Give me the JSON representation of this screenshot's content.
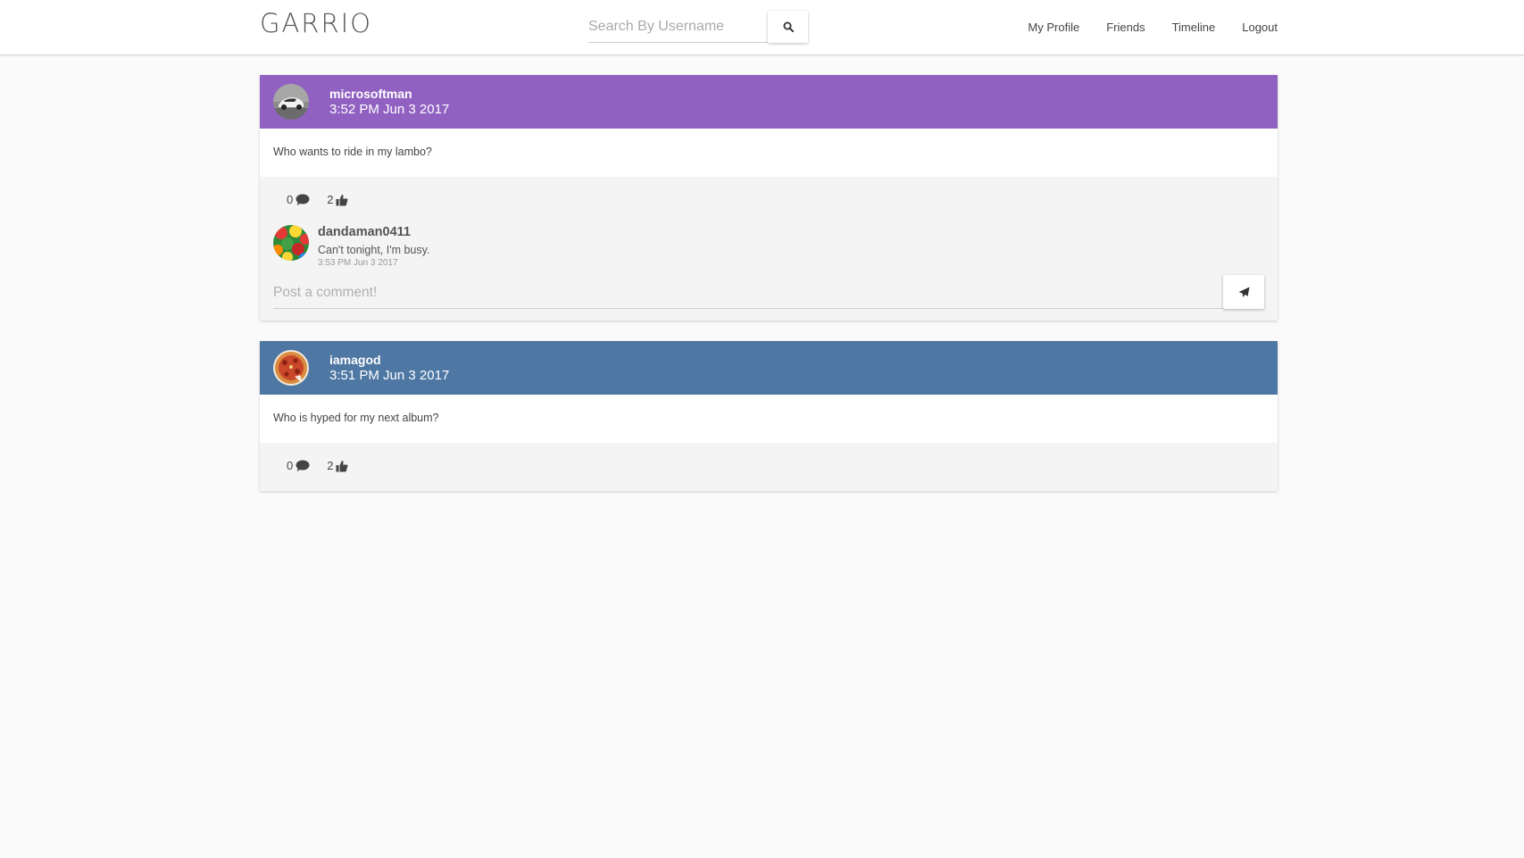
{
  "brand": "GARRIO",
  "search": {
    "placeholder": "Search By Username",
    "button_icon": "search-icon"
  },
  "nav": {
    "links": [
      "My Profile",
      "Friends",
      "Timeline",
      "Logout"
    ]
  },
  "posts": [
    {
      "username": "microsoftman",
      "time": "3:52 PM Jun 3 2017",
      "header_color": "#9161c2",
      "avatar_icon": "car-avatar",
      "text": "Who wants to ride in my lambo?",
      "comment_count": "0",
      "like_count": "2",
      "comments": [
        {
          "username": "dandaman0411",
          "text": "Can't tonight, I'm busy.",
          "time": "3:53 PM Jun 3 2017",
          "avatar_icon": "gummy-bears-avatar"
        }
      ],
      "comment_placeholder": "Post a comment!",
      "send_icon": "paper-plane-icon"
    },
    {
      "username": "iamagod",
      "time": "3:51 PM Jun 3 2017",
      "header_color": "#4e77a3",
      "avatar_icon": "pizza-avatar",
      "text": "Who is hyped for my next album?",
      "comment_count": "0",
      "like_count": "2"
    }
  ]
}
